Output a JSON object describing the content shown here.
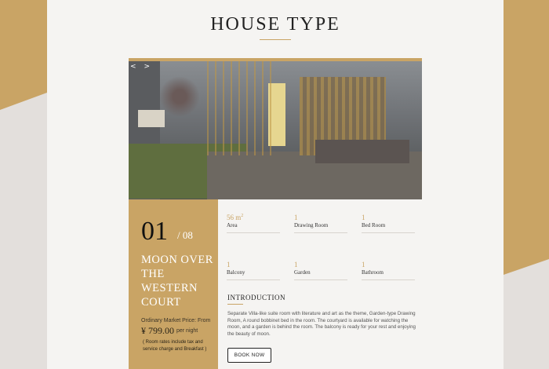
{
  "page": {
    "title": "HOUSE TYPE"
  },
  "gallery": {
    "prev_icon": "chevron-left",
    "next_icon": "chevron-right",
    "prev": "<",
    "next": ">"
  },
  "room": {
    "index": "01",
    "total": "/ 08",
    "name": "MOON OVER THE WESTERN COURT",
    "price_label": "Ordinary Market Price: From",
    "price": "¥ 799.00",
    "price_unit": "per night",
    "price_note": "( Room rates include tax and service charge and Breakfast )"
  },
  "features": [
    {
      "value": "56 m",
      "sup": "2",
      "label": "Area"
    },
    {
      "value": "1",
      "sup": "",
      "label": "Drawing Room"
    },
    {
      "value": "1",
      "sup": "",
      "label": "Bed Room"
    },
    {
      "value": "1",
      "sup": "",
      "label": "Balcony"
    },
    {
      "value": "1",
      "sup": "",
      "label": "Garden"
    },
    {
      "value": "1",
      "sup": "",
      "label": "Bathroom"
    }
  ],
  "intro": {
    "title": "INTRODUCTION",
    "text": "Separate Villa-like suite room with literature and art as the theme, Garden-type Drawing Room, A round bobbinet bed in the room. The courtyard is available for watching the moon, and a garden is behind the room. The balcony is ready for your rest and enjoying the beauty of moon."
  },
  "cta": {
    "book": "BOOK NOW"
  },
  "colors": {
    "gold": "#c9a465",
    "paper": "#f5f4f2",
    "gray": "#e3dfdc"
  }
}
